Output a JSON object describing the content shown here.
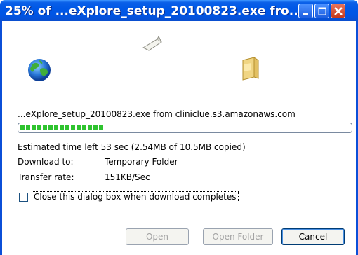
{
  "window": {
    "title": "25% of ...eXplore_setup_20100823.exe fro..."
  },
  "download": {
    "source": "...eXplore_setup_20100823.exe from cliniclue.s3.amazonaws.com",
    "progress_fraction": 0.25,
    "time_left_label": "Estimated time left",
    "time_left_value": "53 sec (2.54MB of 10.5MB copied)",
    "download_to_label": "Download to:",
    "download_to_value": "Temporary Folder",
    "transfer_rate_label": "Transfer rate:",
    "transfer_rate_value": "151KB/Sec",
    "close_checkbox_label": "Close this dialog box when download completes",
    "close_checkbox_checked": false
  },
  "buttons": {
    "open": "Open",
    "open_folder": "Open Folder",
    "cancel": "Cancel"
  },
  "icons": {
    "globe": "globe-icon",
    "paper": "flying-paper-icon",
    "folder": "folder-icon"
  },
  "colors": {
    "titlebar": "#0055e5",
    "progress": "#2ec32e"
  }
}
